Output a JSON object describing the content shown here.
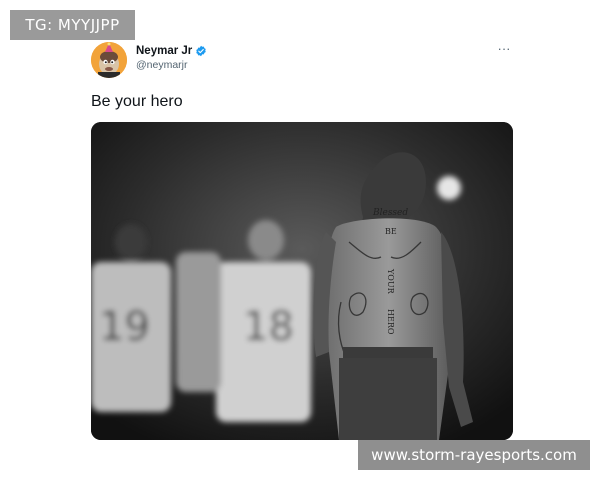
{
  "watermark_top": "TG: MYYJJPP",
  "watermark_bottom": "www.storm-rayesports.com",
  "tweet": {
    "author_name": "Neymar Jr",
    "handle": "@neymarjr",
    "text": "Be your hero",
    "more_icon": "···",
    "verified_color": "#1d9bf0",
    "image": {
      "jersey_left": "19",
      "jersey_mid": "18",
      "tattoo_lines": [
        "Blessed",
        "BE",
        "YOUR",
        "HERO"
      ],
      "icons": [
        "verified-badge-icon",
        "more-options-icon"
      ]
    }
  }
}
